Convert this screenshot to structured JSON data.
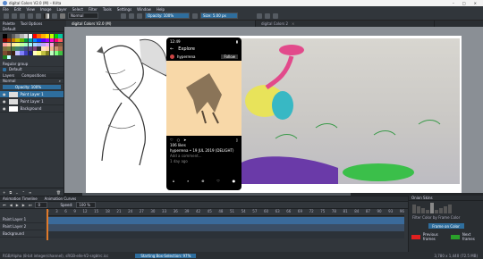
{
  "window": {
    "title": "digital Colors V2.0 (M) – Krita",
    "controls": [
      "–",
      "□",
      "×"
    ]
  },
  "menu": [
    "File",
    "Edit",
    "View",
    "Image",
    "Layer",
    "Select",
    "Filter",
    "Tools",
    "Settings",
    "Window",
    "Help"
  ],
  "toolbar": {
    "blend_mode": "Normal",
    "opacity": "Opacity: 100%",
    "size": "Size: 5.00 px"
  },
  "tabs": [
    {
      "label": "digital Colors V2.0 (M)",
      "active": true
    },
    {
      "label": "digital Colors 2",
      "active": false
    }
  ],
  "left": {
    "header_tabs": [
      "Palette",
      "Tool Options",
      "Overview"
    ],
    "palette_title": "Default",
    "colors": [
      "#000000",
      "#3a3a3a",
      "#5e5e5e",
      "#8a8a8a",
      "#b4b4b4",
      "#dcdcdc",
      "#ffffff",
      "#ff0000",
      "#ff6a00",
      "#ffb000",
      "#ffe600",
      "#c4ff00",
      "#00d800",
      "#00c8a0",
      "#7a0000",
      "#a83400",
      "#c87a00",
      "#c8c400",
      "#6ab400",
      "#009a3a",
      "#00a8a8",
      "#0088ff",
      "#0040ff",
      "#5a00ff",
      "#a000ff",
      "#ff00d0",
      "#ff0070",
      "#ff5a5a",
      "#ffa0a0",
      "#ffc89a",
      "#ffeaa0",
      "#f4ffa0",
      "#c4ffa0",
      "#a0ffc0",
      "#a0fff4",
      "#a0d8ff",
      "#a0b4ff",
      "#c0a0ff",
      "#f0a0ff",
      "#ffa0dc",
      "#804040",
      "#805a40",
      "#807040",
      "#788040",
      "#508040",
      "#40806a",
      "#406a80",
      "#404a80",
      "#604080",
      "#804078",
      "#2e2e2e",
      "#ffe0c0",
      "#ffd2b0",
      "#f0b48c",
      "#d09070",
      "#a87050",
      "#804c30",
      "#5a3420",
      "#3a2010",
      "#c0c0ff",
      "#8080ff",
      "#4040c0",
      "#202080",
      "#ffffc0",
      "#ffff80",
      "#c0c040",
      "#808020",
      "#c0ffc0",
      "#80ff80",
      "#40c040",
      "#208020",
      "#c0ffff"
    ],
    "regular_group": "Regular group",
    "label": "Default",
    "layers_tabs": [
      "Layers",
      "Compositions"
    ],
    "blend": "Normal",
    "opacity": "Opacity: 100%",
    "layers": [
      {
        "name": "Paint Layer 1",
        "selected": true
      },
      {
        "name": "Paint Layer 1",
        "selected": false
      },
      {
        "name": "Background",
        "selected": false
      }
    ]
  },
  "animation": {
    "tabs": [
      "Animation Timeline",
      "Animation Curves"
    ],
    "fps_label": "Speed:",
    "fps": "100 %",
    "frame": "0",
    "rows": [
      "Paint Layer 1",
      "Paint Layer 2",
      "Background"
    ],
    "ruler": [
      "0",
      "3",
      "6",
      "9",
      "12",
      "15",
      "18",
      "21",
      "24",
      "27",
      "30",
      "33",
      "36",
      "39",
      "42",
      "45",
      "48",
      "51",
      "54",
      "57",
      "60",
      "63",
      "66",
      "69",
      "72",
      "75",
      "78",
      "81",
      "84",
      "87",
      "90",
      "93",
      "96"
    ]
  },
  "scrubber": {
    "title": "Onion Skins",
    "label": "Filter Color by Frame Color",
    "button": "Frame on Color",
    "prev": "Previous frames",
    "next": "Next frames",
    "prev_color": "#e02020",
    "next_color": "#2aa02a"
  },
  "phone": {
    "time": "12:49",
    "header": "Explore",
    "user": "hyperrena",
    "follow": "Follow",
    "likes": "106 likes",
    "caption": "hyperrena • 19 JUL 2019 (DELIGHT)",
    "comment": "Add a comment...",
    "ago": "1 day ago"
  },
  "status": {
    "left": "RGB/Alpha (8-bit integer/channel), sRGB-elle-V2-srgbtrc.icc",
    "center": "Starting Box-Selection: 97%",
    "right": "3,780 x 1,440 (72.5 MB)"
  }
}
